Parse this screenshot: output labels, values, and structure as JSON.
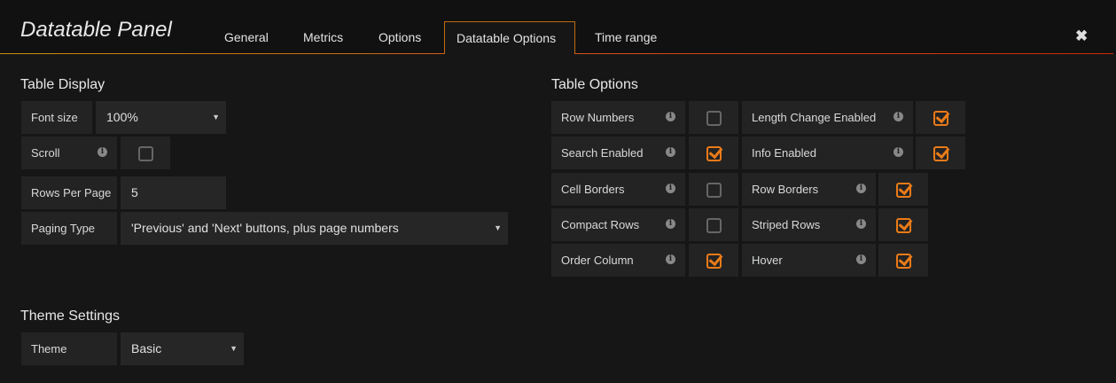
{
  "header": {
    "title": "Datatable Panel",
    "tabs": [
      "General",
      "Metrics",
      "Options",
      "Datatable Options",
      "Time range"
    ],
    "active_tab": "Datatable Options",
    "close_icon": "close-icon"
  },
  "table_display": {
    "heading": "Table Display",
    "font_size": {
      "label": "Font size",
      "value": "100%"
    },
    "scroll": {
      "label": "Scroll",
      "checked": false
    },
    "rows_per_page": {
      "label": "Rows Per Page",
      "value": "5"
    },
    "paging_type": {
      "label": "Paging Type",
      "value": "'Previous' and 'Next' buttons, plus page numbers"
    }
  },
  "theme_settings": {
    "heading": "Theme Settings",
    "theme": {
      "label": "Theme",
      "value": "Basic"
    }
  },
  "table_options": {
    "heading": "Table Options",
    "items": [
      {
        "label": "Row Numbers",
        "checked": false
      },
      {
        "label": "Length Change Enabled",
        "checked": true
      },
      {
        "label": "Search Enabled",
        "checked": true
      },
      {
        "label": "Info Enabled",
        "checked": true
      },
      {
        "label": "Cell Borders",
        "checked": false
      },
      {
        "label": "Row Borders",
        "checked": true
      },
      {
        "label": "Compact Rows",
        "checked": false
      },
      {
        "label": "Striped Rows",
        "checked": true
      },
      {
        "label": "Order Column",
        "checked": true
      },
      {
        "label": "Hover",
        "checked": true
      }
    ]
  },
  "colors": {
    "accent": "#eb7b18"
  }
}
